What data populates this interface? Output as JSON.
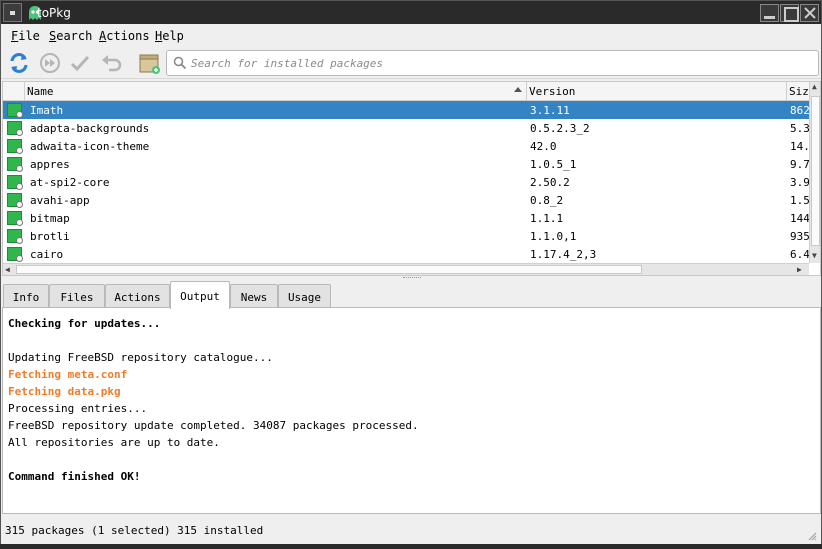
{
  "window": {
    "title": "toPkg"
  },
  "menubar": [
    {
      "label": "File",
      "mnemonic": "F",
      "rest": "ile"
    },
    {
      "label": "Search",
      "mnemonic": "S",
      "rest": "earch"
    },
    {
      "label": "Actions",
      "mnemonic": "A",
      "rest": "ctions"
    },
    {
      "label": "Help",
      "mnemonic": "H",
      "rest": "elp"
    }
  ],
  "search": {
    "placeholder": "Search for installed packages"
  },
  "table": {
    "columns": {
      "name": "Name",
      "version": "Version",
      "size": "Size"
    },
    "rows": [
      {
        "name": "Imath",
        "version": "3.1.11",
        "size": "862",
        "selected": true
      },
      {
        "name": "adapta-backgrounds",
        "version": "0.5.2.3_2",
        "size": "5.3"
      },
      {
        "name": "adwaita-icon-theme",
        "version": "42.0",
        "size": "14."
      },
      {
        "name": "appres",
        "version": "1.0.5_1",
        "size": "9.7"
      },
      {
        "name": "at-spi2-core",
        "version": "2.50.2",
        "size": "3.9"
      },
      {
        "name": "avahi-app",
        "version": "0.8_2",
        "size": "1.5"
      },
      {
        "name": "bitmap",
        "version": "1.1.1",
        "size": "144"
      },
      {
        "name": "brotli",
        "version": "1.1.0,1",
        "size": "935"
      },
      {
        "name": "cairo",
        "version": "1.17.4_2,3",
        "size": "6.4"
      }
    ]
  },
  "tabs": [
    {
      "label": "Info"
    },
    {
      "label": "Files"
    },
    {
      "label": "Actions"
    },
    {
      "label": "Output",
      "active": true
    },
    {
      "label": "News"
    },
    {
      "label": "Usage"
    }
  ],
  "output": {
    "l1": "Checking for updates...",
    "l2": "",
    "l3": "Updating FreeBSD repository catalogue...",
    "l4": "Fetching meta.conf",
    "l5": "Fetching data.pkg",
    "l6": "Processing entries...",
    "l7": "FreeBSD repository update completed. 34087 packages processed.",
    "l8": "All repositories are up to date.",
    "l9": "",
    "l10": "Command finished OK!"
  },
  "status": {
    "text": "315 packages (1 selected)  315 installed"
  },
  "colors": {
    "selection": "#3484c4",
    "fetch_text": "#f07c2a",
    "package_icon": "#2fb74e",
    "refresh_icon": "#2b7fd4"
  },
  "icons": [
    "ghost-app-icon",
    "refresh-icon",
    "fast-forward-icon",
    "check-icon",
    "undo-icon",
    "package-box-icon",
    "search-icon"
  ]
}
